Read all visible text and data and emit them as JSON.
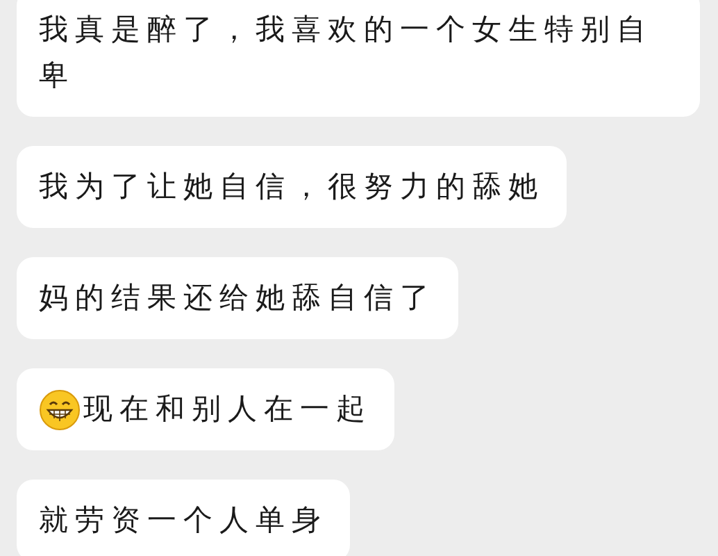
{
  "messages": [
    {
      "kind": "text",
      "text": "我真是醉了，我喜欢的一个女生特别自卑"
    },
    {
      "kind": "text",
      "text": "我为了让她自信，很努力的舔她"
    },
    {
      "kind": "text",
      "text": "妈的结果还给她舔自信了"
    },
    {
      "kind": "emoji_text",
      "text": "现在和别人在一起"
    },
    {
      "kind": "text",
      "text": "就劳资一个人单身"
    }
  ]
}
